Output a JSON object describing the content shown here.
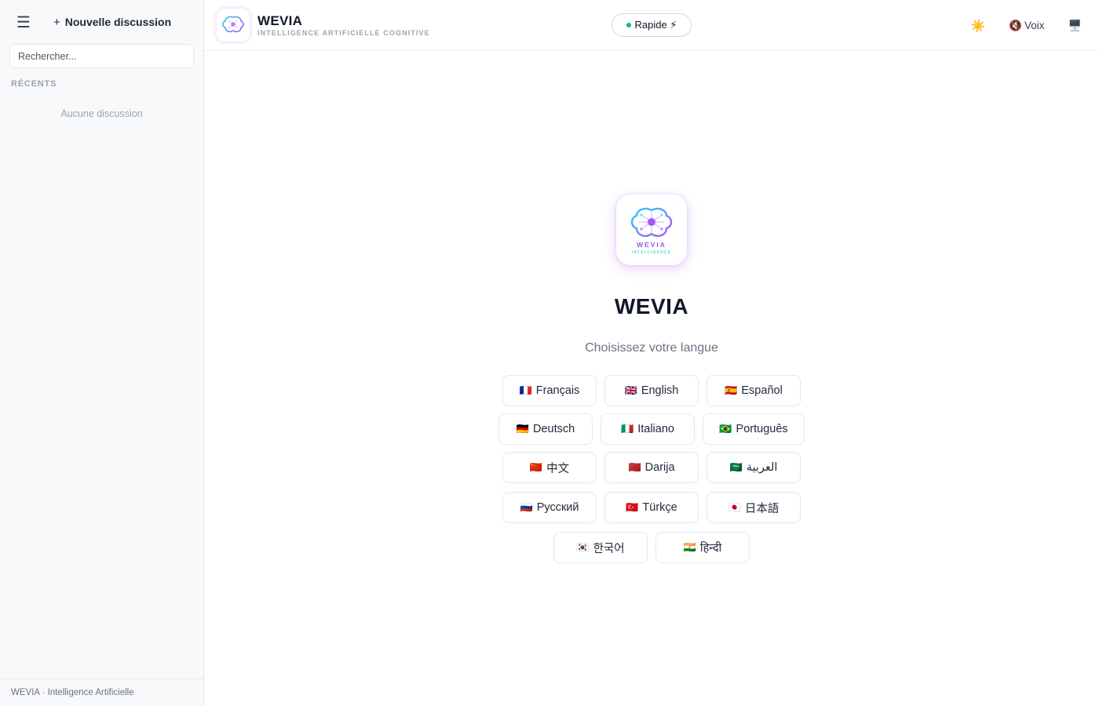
{
  "sidebar": {
    "new_chat_label": "Nouvelle discussion",
    "search_placeholder": "Rechercher...",
    "recents_label": "RÉCENTS",
    "empty_label": "Aucune discussion",
    "footer": "WEVIA · Intelligence Artificielle"
  },
  "header": {
    "brand_name": "WEVIA",
    "brand_subtitle": "INTELLIGENCE ARTIFICIELLE COGNITIVE",
    "mode_label": "Rapide ⚡",
    "theme_icon": "☀️",
    "voice_icon": "🔇",
    "voice_label": "Voix",
    "screen_icon": "🖥️"
  },
  "welcome": {
    "logo_word": "WEVIA",
    "logo_sub": "INTELLIGENCE",
    "title": "WEVIA",
    "subtitle": "Choisissez votre langue",
    "languages": [
      {
        "flag": "🇫🇷",
        "label": "Français"
      },
      {
        "flag": "🇬🇧",
        "label": "English"
      },
      {
        "flag": "🇪🇸",
        "label": "Español"
      },
      {
        "flag": "🇩🇪",
        "label": "Deutsch"
      },
      {
        "flag": "🇮🇹",
        "label": "Italiano"
      },
      {
        "flag": "🇧🇷",
        "label": "Português"
      },
      {
        "flag": "🇨🇳",
        "label": "中文"
      },
      {
        "flag": "🇲🇦",
        "label": "Darija"
      },
      {
        "flag": "🇸🇦",
        "label": "العربية"
      },
      {
        "flag": "🇷🇺",
        "label": "Русский"
      },
      {
        "flag": "🇹🇷",
        "label": "Türkçe"
      },
      {
        "flag": "🇯🇵",
        "label": "日本語"
      },
      {
        "flag": "🇰🇷",
        "label": "한국어"
      },
      {
        "flag": "🇮🇳",
        "label": "हिन्दी"
      }
    ]
  },
  "colors": {
    "accent_purple": "#8b5cf6",
    "accent_cyan": "#22b8cf",
    "status_green": "#10b981"
  }
}
